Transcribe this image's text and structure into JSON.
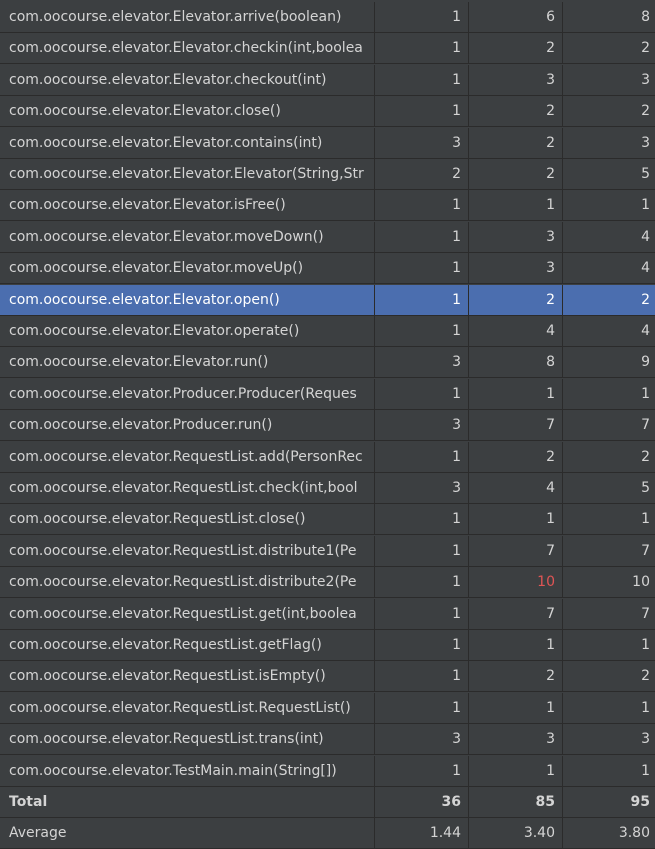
{
  "rows": [
    {
      "method": "com.oocourse.elevator.Elevator.arrive(boolean)",
      "v1": "1",
      "v2": "6",
      "v3": "8"
    },
    {
      "method": "com.oocourse.elevator.Elevator.checkin(int,boolea",
      "v1": "1",
      "v2": "2",
      "v3": "2"
    },
    {
      "method": "com.oocourse.elevator.Elevator.checkout(int)",
      "v1": "1",
      "v2": "3",
      "v3": "3"
    },
    {
      "method": "com.oocourse.elevator.Elevator.close()",
      "v1": "1",
      "v2": "2",
      "v3": "2"
    },
    {
      "method": "com.oocourse.elevator.Elevator.contains(int)",
      "v1": "3",
      "v2": "2",
      "v3": "3"
    },
    {
      "method": "com.oocourse.elevator.Elevator.Elevator(String,Str",
      "v1": "2",
      "v2": "2",
      "v3": "5"
    },
    {
      "method": "com.oocourse.elevator.Elevator.isFree()",
      "v1": "1",
      "v2": "1",
      "v3": "1"
    },
    {
      "method": "com.oocourse.elevator.Elevator.moveDown()",
      "v1": "1",
      "v2": "3",
      "v3": "4"
    },
    {
      "method": "com.oocourse.elevator.Elevator.moveUp()",
      "v1": "1",
      "v2": "3",
      "v3": "4"
    },
    {
      "method": "com.oocourse.elevator.Elevator.open()",
      "v1": "1",
      "v2": "2",
      "v3": "2",
      "selected": true
    },
    {
      "method": "com.oocourse.elevator.Elevator.operate()",
      "v1": "1",
      "v2": "4",
      "v3": "4"
    },
    {
      "method": "com.oocourse.elevator.Elevator.run()",
      "v1": "3",
      "v2": "8",
      "v3": "9"
    },
    {
      "method": "com.oocourse.elevator.Producer.Producer(Reques",
      "v1": "1",
      "v2": "1",
      "v3": "1"
    },
    {
      "method": "com.oocourse.elevator.Producer.run()",
      "v1": "3",
      "v2": "7",
      "v3": "7"
    },
    {
      "method": "com.oocourse.elevator.RequestList.add(PersonRec",
      "v1": "1",
      "v2": "2",
      "v3": "2"
    },
    {
      "method": "com.oocourse.elevator.RequestList.check(int,bool",
      "v1": "3",
      "v2": "4",
      "v3": "5"
    },
    {
      "method": "com.oocourse.elevator.RequestList.close()",
      "v1": "1",
      "v2": "1",
      "v3": "1"
    },
    {
      "method": "com.oocourse.elevator.RequestList.distribute1(Pe",
      "v1": "1",
      "v2": "7",
      "v3": "7"
    },
    {
      "method": "com.oocourse.elevator.RequestList.distribute2(Pe",
      "v1": "1",
      "v2": "10",
      "v3": "10",
      "v2_highlight": true
    },
    {
      "method": "com.oocourse.elevator.RequestList.get(int,boolea",
      "v1": "1",
      "v2": "7",
      "v3": "7"
    },
    {
      "method": "com.oocourse.elevator.RequestList.getFlag()",
      "v1": "1",
      "v2": "1",
      "v3": "1"
    },
    {
      "method": "com.oocourse.elevator.RequestList.isEmpty()",
      "v1": "1",
      "v2": "2",
      "v3": "2"
    },
    {
      "method": "com.oocourse.elevator.RequestList.RequestList()",
      "v1": "1",
      "v2": "1",
      "v3": "1"
    },
    {
      "method": "com.oocourse.elevator.RequestList.trans(int)",
      "v1": "3",
      "v2": "3",
      "v3": "3"
    },
    {
      "method": "com.oocourse.elevator.TestMain.main(String[])",
      "v1": "1",
      "v2": "1",
      "v3": "1"
    }
  ],
  "total": {
    "label": "Total",
    "v1": "36",
    "v2": "85",
    "v3": "95"
  },
  "average": {
    "label": "Average",
    "v1": "1.44",
    "v2": "3.40",
    "v3": "3.80"
  },
  "colors": {
    "background": "#3c3f41",
    "selected_row": "#4b6eaf",
    "grid_line": "#2b2b2b",
    "text": "#d4d4d4",
    "highlight_value": "#e05555"
  }
}
